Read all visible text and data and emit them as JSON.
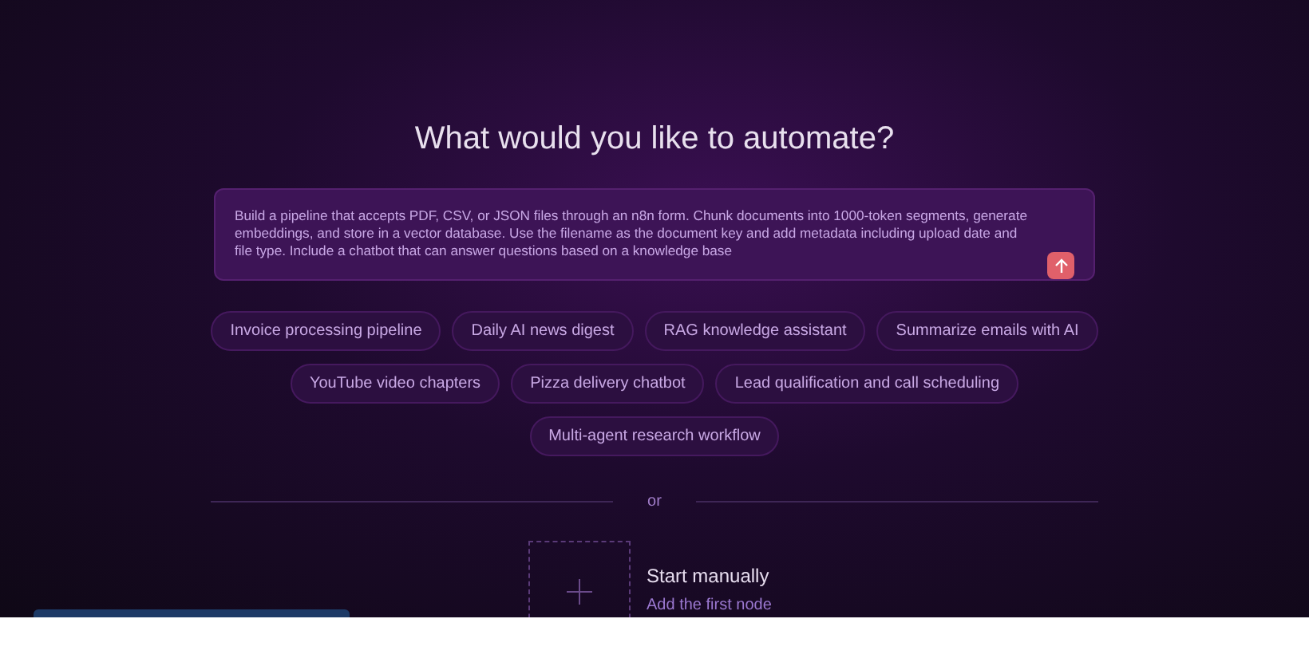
{
  "heading": "What would you like to automate?",
  "prompt": {
    "value": "Build a pipeline that accepts PDF, CSV, or JSON files through an n8n form. Chunk documents into 1000-token segments, generate embeddings, and store in a vector database. Use the filename as the document key and add metadata including upload date and file type. Include a chatbot that can answer questions based on a knowledge base"
  },
  "suggestions": [
    [
      "Invoice processing pipeline",
      "Daily AI news digest",
      "RAG knowledge assistant",
      "Summarize emails with AI"
    ],
    [
      "YouTube video chapters",
      "Pizza delivery chatbot",
      "Lead qualification and call scheduling"
    ],
    [
      "Multi-agent research workflow"
    ]
  ],
  "divider_text": "or",
  "start_manually": {
    "title": "Start manually",
    "subtitle": "Add the first node"
  }
}
